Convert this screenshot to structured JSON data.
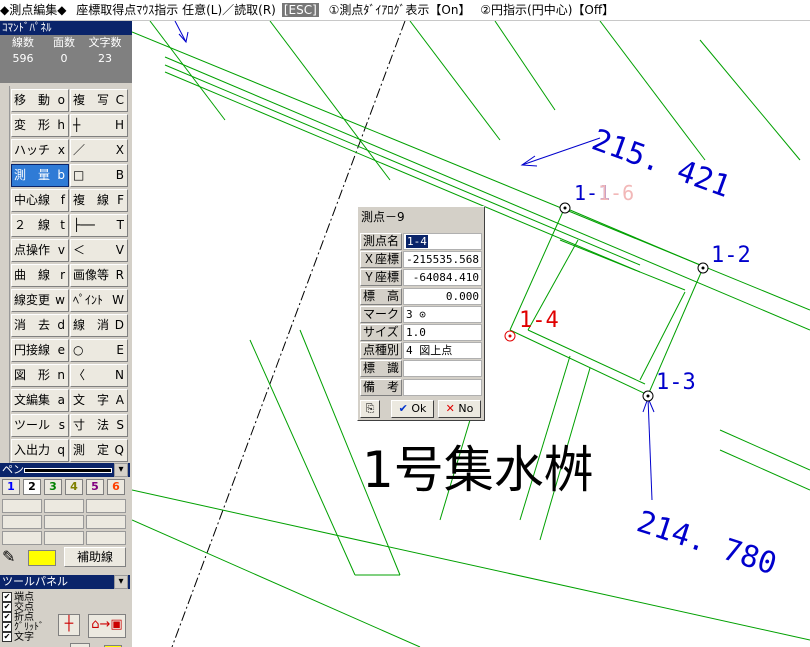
{
  "topbar": {
    "mode": "◆測点編集◆",
    "hint": "座標取得点ﾏｳｽ指示 任意(L)／読取(R)",
    "esc": "[ESC]",
    "opt1": "①測点ﾀﾞｲｱﾛｸﾞ表示【On】",
    "opt2": "②円指示(円中心)【Off】"
  },
  "command_panel": {
    "title": "ｺﾏﾝﾄﾞﾊﾟﾈﾙ",
    "stats": {
      "headers": [
        "線数",
        "面数",
        "文字数"
      ],
      "values": [
        "596",
        "0",
        "23"
      ]
    },
    "buttons": [
      {
        "label": "移　動",
        "key": "o"
      },
      {
        "label": "複　写",
        "key": "C"
      },
      {
        "label": "変　形",
        "key": "h"
      },
      {
        "label": "┼",
        "key": "H"
      },
      {
        "label": "ハッチ",
        "key": "x"
      },
      {
        "label": "／",
        "key": "X"
      },
      {
        "label": "測　量",
        "key": "b"
      },
      {
        "label": "□",
        "key": "B"
      },
      {
        "label": "中心線",
        "key": "f"
      },
      {
        "label": "複　線",
        "key": "F"
      },
      {
        "label": "２　線",
        "key": "t"
      },
      {
        "label": "├──",
        "key": "T"
      },
      {
        "label": "点操作",
        "key": "v"
      },
      {
        "label": "＜",
        "key": "V"
      },
      {
        "label": "曲　線",
        "key": "r"
      },
      {
        "label": "画像等",
        "key": "R"
      },
      {
        "label": "線変更",
        "key": "w"
      },
      {
        "label": "ﾍﾟｲﾝﾄ",
        "key": "W"
      },
      {
        "label": "消　去",
        "key": "d"
      },
      {
        "label": "線　消",
        "key": "D"
      },
      {
        "label": "円接線",
        "key": "e"
      },
      {
        "label": "○",
        "key": "E"
      },
      {
        "label": "図　形",
        "key": "n"
      },
      {
        "label": "〈",
        "key": "N"
      },
      {
        "label": "文編集",
        "key": "a"
      },
      {
        "label": "文　字",
        "key": "A"
      },
      {
        "label": "ツール",
        "key": "s"
      },
      {
        "label": "寸　法",
        "key": "S"
      },
      {
        "label": "入出力",
        "key": "q"
      },
      {
        "label": "測　定",
        "key": "Q"
      }
    ]
  },
  "pen_panel": {
    "title": "ペン",
    "pens": [
      "1",
      "2",
      "3",
      "4",
      "5",
      "6"
    ],
    "pen_colors": [
      "#0000ff",
      "#000000",
      "#008000",
      "#808000",
      "#800080",
      "#ff4000"
    ],
    "aux_label": "補助線"
  },
  "tool_panel": {
    "title": "ツールパネル",
    "snaps": [
      "端点",
      "交点",
      "折点",
      "ｸﾞﾘｯﾄﾞ",
      "文字"
    ]
  },
  "drawing": {
    "dim_top": "215. 421",
    "dim_bottom": "214. 780",
    "title": "1号集水桝",
    "pt_11": "1-1",
    "pt_16": "1-6",
    "pt_12": "1-2",
    "pt_13": "1-3",
    "pt_14": "1-4"
  },
  "dialog": {
    "title": "測点－9",
    "rows": [
      {
        "label": "測点名",
        "value": "1-4"
      },
      {
        "label": "Ｘ座標",
        "value": "-215535.568"
      },
      {
        "label": "Ｙ座標",
        "value": "-64084.410"
      },
      {
        "label": "標　高",
        "value": "0.000"
      },
      {
        "label": "マーク",
        "value": "3 ⊙"
      },
      {
        "label": "サイズ",
        "value": "1.0"
      },
      {
        "label": "点種別",
        "value": "4 図上点"
      },
      {
        "label": "標　識",
        "value": ""
      },
      {
        "label": "備　考",
        "value": ""
      }
    ],
    "ok_label": "Ok",
    "no_label": "No"
  }
}
